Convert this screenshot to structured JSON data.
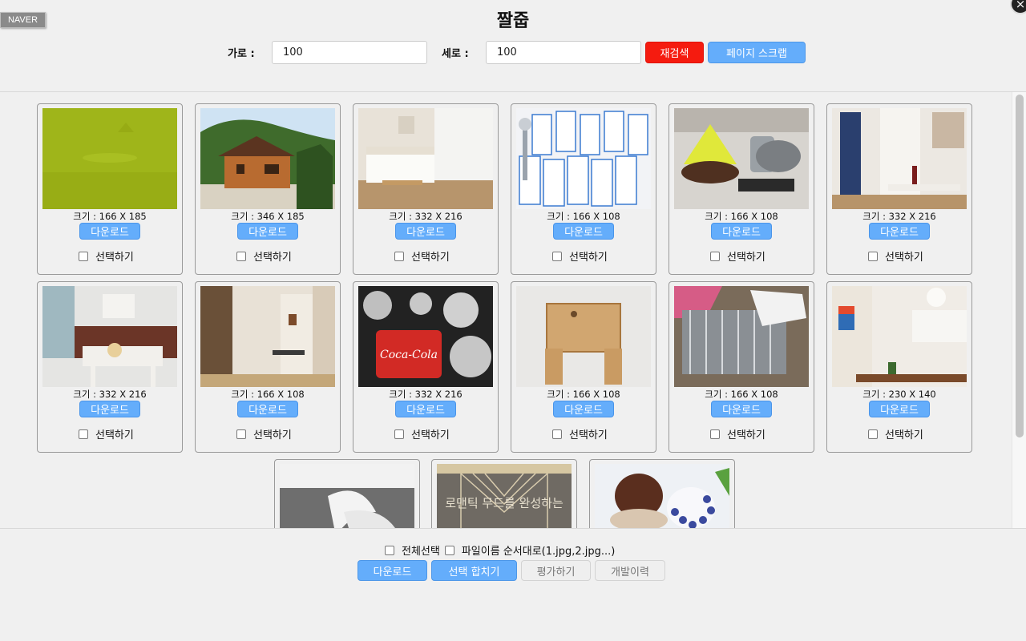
{
  "app": {
    "title": "짤줍",
    "naver_badge": "NAVER",
    "close_symbol": "×"
  },
  "toolbar": {
    "width_label": "가로 :",
    "width_value": "100",
    "height_label": "세로 :",
    "height_value": "100",
    "research_button": "재검색",
    "page_scrap_button": "페이지 스크랩"
  },
  "cards": [
    {
      "size": "크기 : 166 X 185",
      "thumb": "olive-room"
    },
    {
      "size": "크기 : 346 X 185",
      "thumb": "wooden-house"
    },
    {
      "size": "크기 : 332 X 216",
      "thumb": "bedroom"
    },
    {
      "size": "크기 : 166 X 108",
      "thumb": "shower-heads"
    },
    {
      "size": "크기 : 166 X 108",
      "thumb": "kitchen-items"
    },
    {
      "size": "크기 : 332 X 216",
      "thumb": "hallway"
    },
    {
      "size": "크기 : 332 X 216",
      "thumb": "balcony-table"
    },
    {
      "size": "크기 : 166 X 108",
      "thumb": "corridor"
    },
    {
      "size": "크기 : 332 X 216",
      "thumb": "coke-tins"
    },
    {
      "size": "크기 : 166 X 108",
      "thumb": "wooden-stool"
    },
    {
      "size": "크기 : 166 X 108",
      "thumb": "dish-rack"
    },
    {
      "size": "크기 : 230 X 140",
      "thumb": "kitchen-room"
    },
    {
      "size": "",
      "thumb": "flowers"
    },
    {
      "size": "",
      "thumb": "macrame",
      "overlay_text": "로맨틱 무드를 완성하는"
    },
    {
      "size": "",
      "thumb": "dessert"
    }
  ],
  "card_labels": {
    "download": "다운로드",
    "select": "선택하기"
  },
  "bottom": {
    "select_all": "전체선택",
    "filename_order": "파일이름 순서대로(1.jpg,2.jpg...)",
    "download_button": "다운로드",
    "merge_button": "선택 합치기",
    "rate_button": "평가하기",
    "history_button": "개발이력"
  }
}
